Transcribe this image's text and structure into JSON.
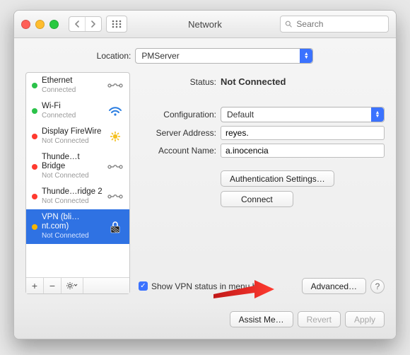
{
  "window": {
    "title": "Network"
  },
  "search": {
    "placeholder": "Search"
  },
  "location": {
    "label": "Location:",
    "value": "PMServer"
  },
  "services": [
    {
      "name": "Ethernet",
      "status": "Connected",
      "dot": "#2bc24a",
      "icon": "ethernet"
    },
    {
      "name": "Wi-Fi",
      "status": "Connected",
      "dot": "#2bc24a",
      "icon": "wifi"
    },
    {
      "name": "Display FireWire",
      "status": "Not Connected",
      "dot": "#ff3a2f",
      "icon": "firewire"
    },
    {
      "name": "Thunde…t Bridge",
      "status": "Not Connected",
      "dot": "#ff3a2f",
      "icon": "ethernet"
    },
    {
      "name": "Thunde…ridge 2",
      "status": "Not Connected",
      "dot": "#ff3a2f",
      "icon": "ethernet"
    },
    {
      "name": "VPN (bli…nt.com)",
      "status": "Not Connected",
      "dot": "#f7b500",
      "icon": "lock",
      "selected": true
    }
  ],
  "detail": {
    "status_label": "Status:",
    "status_value": "Not Connected",
    "config_label": "Configuration:",
    "config_value": "Default",
    "server_label": "Server Address:",
    "server_value": "reyes.",
    "account_label": "Account Name:",
    "account_value": "a.inocencia",
    "auth_button": "Authentication Settings…",
    "connect_button": "Connect",
    "menubar_label": "Show VPN status in menu bar",
    "menubar_checked": true,
    "advanced_button": "Advanced…"
  },
  "footer": {
    "assist": "Assist Me…",
    "revert": "Revert",
    "apply": "Apply"
  }
}
